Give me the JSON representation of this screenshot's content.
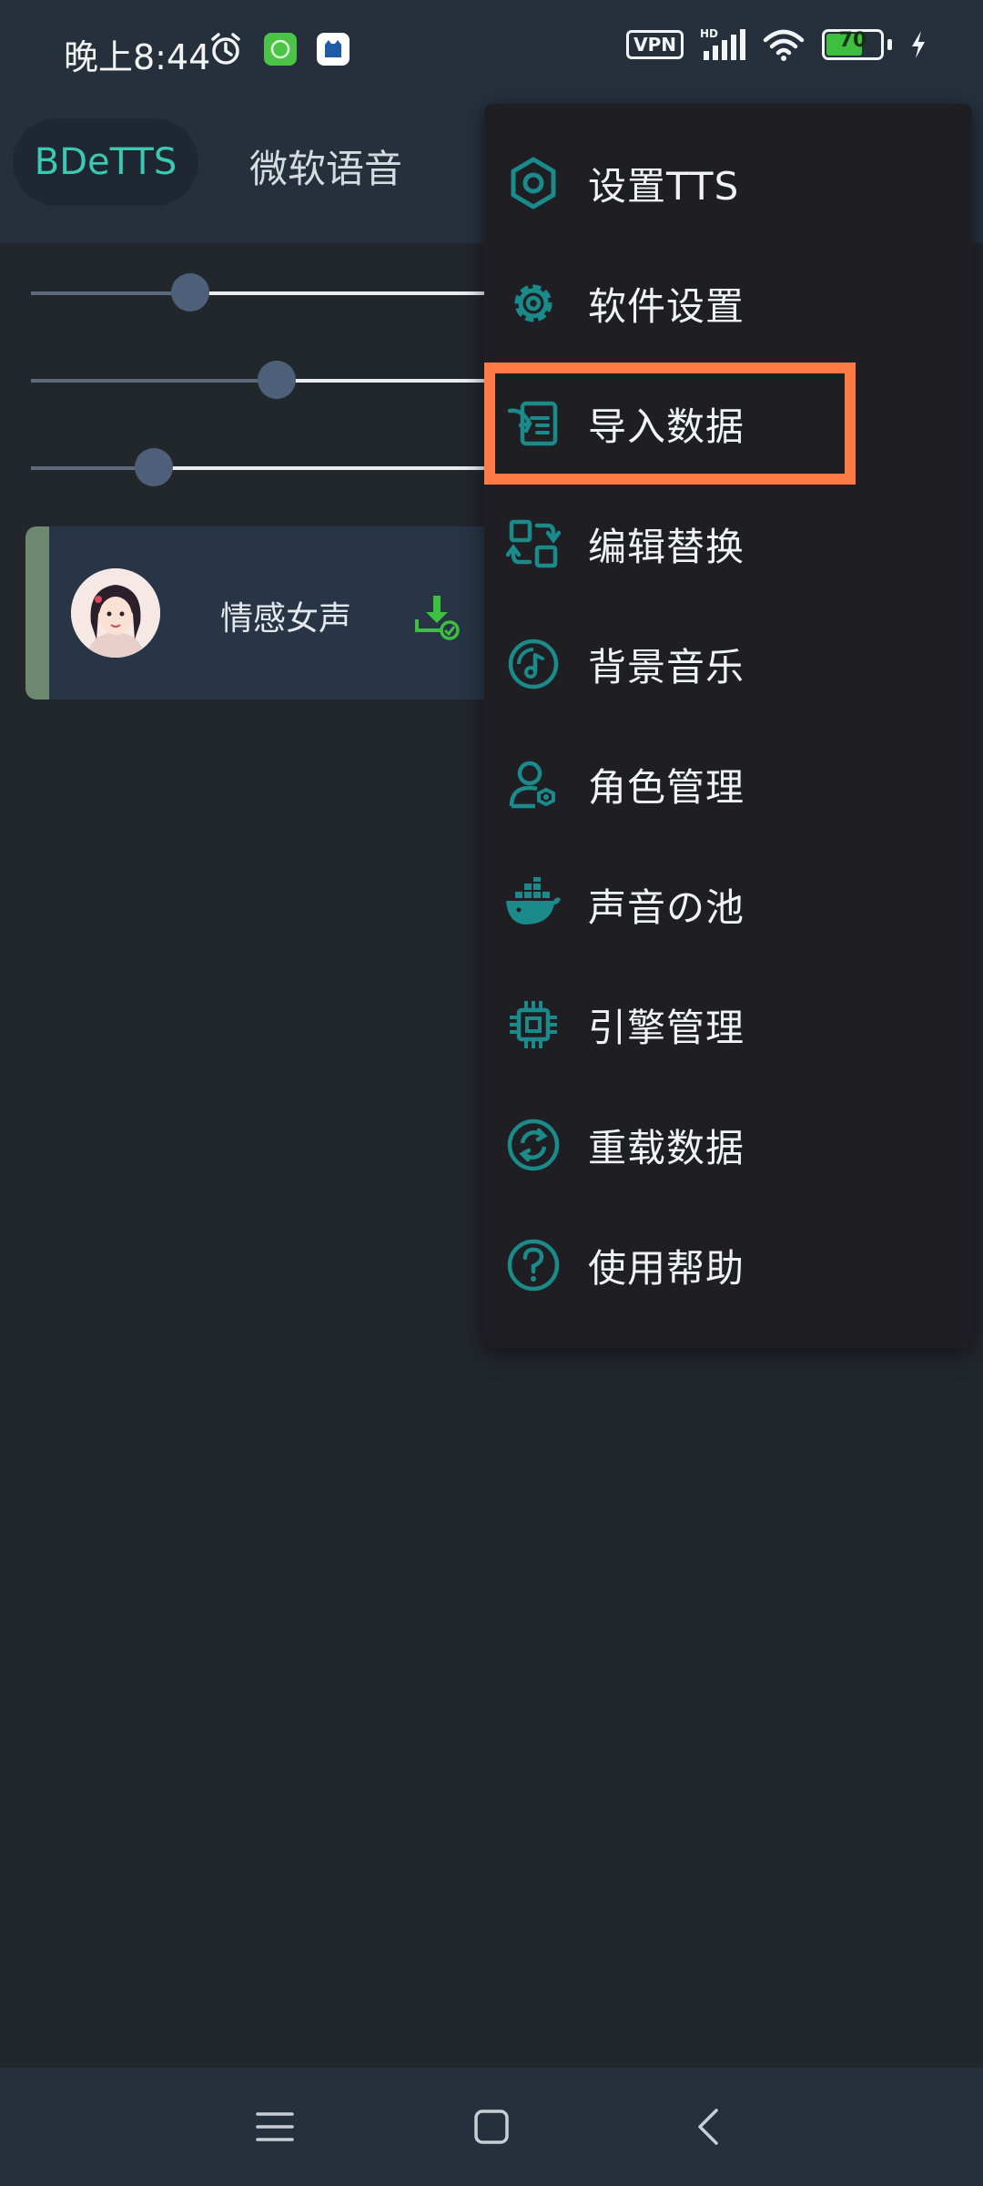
{
  "status_bar": {
    "time": "晚上8:44",
    "vpn": "VPN",
    "network": "HD",
    "battery_level": "70",
    "battery_percent": 70
  },
  "tabs": [
    {
      "label": "BDeTTS",
      "selected": true
    },
    {
      "label": "微软语音",
      "selected": false
    }
  ],
  "sliders": [
    {
      "value_fraction": 0.35
    },
    {
      "value_fraction": 0.54
    },
    {
      "value_fraction": 0.27
    }
  ],
  "voice_card": {
    "name": "情感女声"
  },
  "menu": {
    "items": [
      {
        "label": "设置TTS",
        "icon": "hexagon-settings-icon"
      },
      {
        "label": "软件设置",
        "icon": "gear-icon"
      },
      {
        "label": "导入数据",
        "icon": "import-icon",
        "highlighted": true
      },
      {
        "label": "编辑替换",
        "icon": "replace-icon"
      },
      {
        "label": "背景音乐",
        "icon": "music-disc-icon"
      },
      {
        "label": "角色管理",
        "icon": "user-settings-icon"
      },
      {
        "label": "声音の池",
        "icon": "docker-whale-icon"
      },
      {
        "label": "引擎管理",
        "icon": "chip-icon"
      },
      {
        "label": "重载数据",
        "icon": "reload-icon"
      },
      {
        "label": "使用帮助",
        "icon": "help-icon"
      }
    ]
  },
  "colors": {
    "accent_teal": "#1a8a8a",
    "tab_active": "#3cc9b4",
    "highlight": "#ff7a45",
    "download_green": "#3fbf3f"
  }
}
